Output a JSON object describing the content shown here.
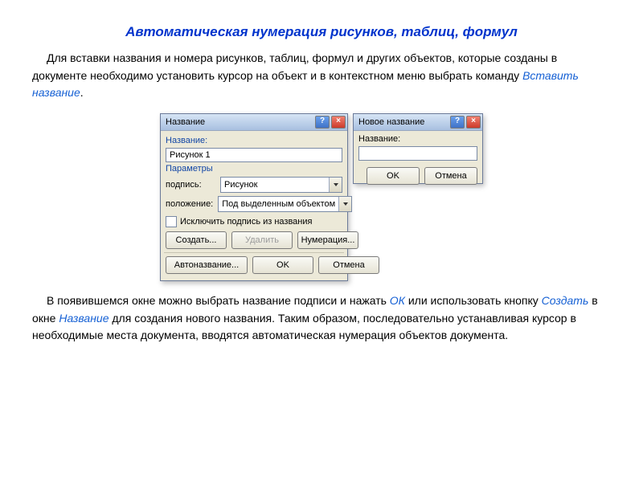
{
  "title": "Автоматическая нумерация рисунков, таблиц, формул",
  "intro": {
    "pre": "Для вставки названия и номера рисунков, таблиц, формул и других объектов, которые созданы в документе необходимо установить курсор на объект и в контекстном меню выбрать команду ",
    "cmd": "Вставить название",
    "post": "."
  },
  "dlg_caption": {
    "title": "Название",
    "field_label": "Название:",
    "field_value": "Рисунок 1",
    "params_label": "Параметры",
    "caption_label": "подпись:",
    "caption_value": "Рисунок",
    "position_label": "положение:",
    "position_value": "Под выделенным объектом",
    "checkbox_label": "Исключить подпись из названия",
    "btn_create": "Создать...",
    "btn_delete": "Удалить",
    "btn_number": "Нумерация...",
    "btn_autoname": "Автоназвание...",
    "btn_ok": "OK",
    "btn_cancel": "Отмена"
  },
  "dlg_new": {
    "title": "Новое название",
    "field_label": "Название:",
    "btn_ok": "OK",
    "btn_cancel": "Отмена"
  },
  "outro": {
    "p1a": "В появившемся окне можно выбрать название подписи и нажать ",
    "p1b": "ОК",
    "p1c": " или использовать кнопку ",
    "p1d": "Создать",
    "p1e": " в окне ",
    "p1f": "Название",
    "p1g": " для создания нового названия. Таким образом, последовательно устанавливая курсор в необходимые места документа, вводятся  автоматическая нумерация объектов документа."
  }
}
